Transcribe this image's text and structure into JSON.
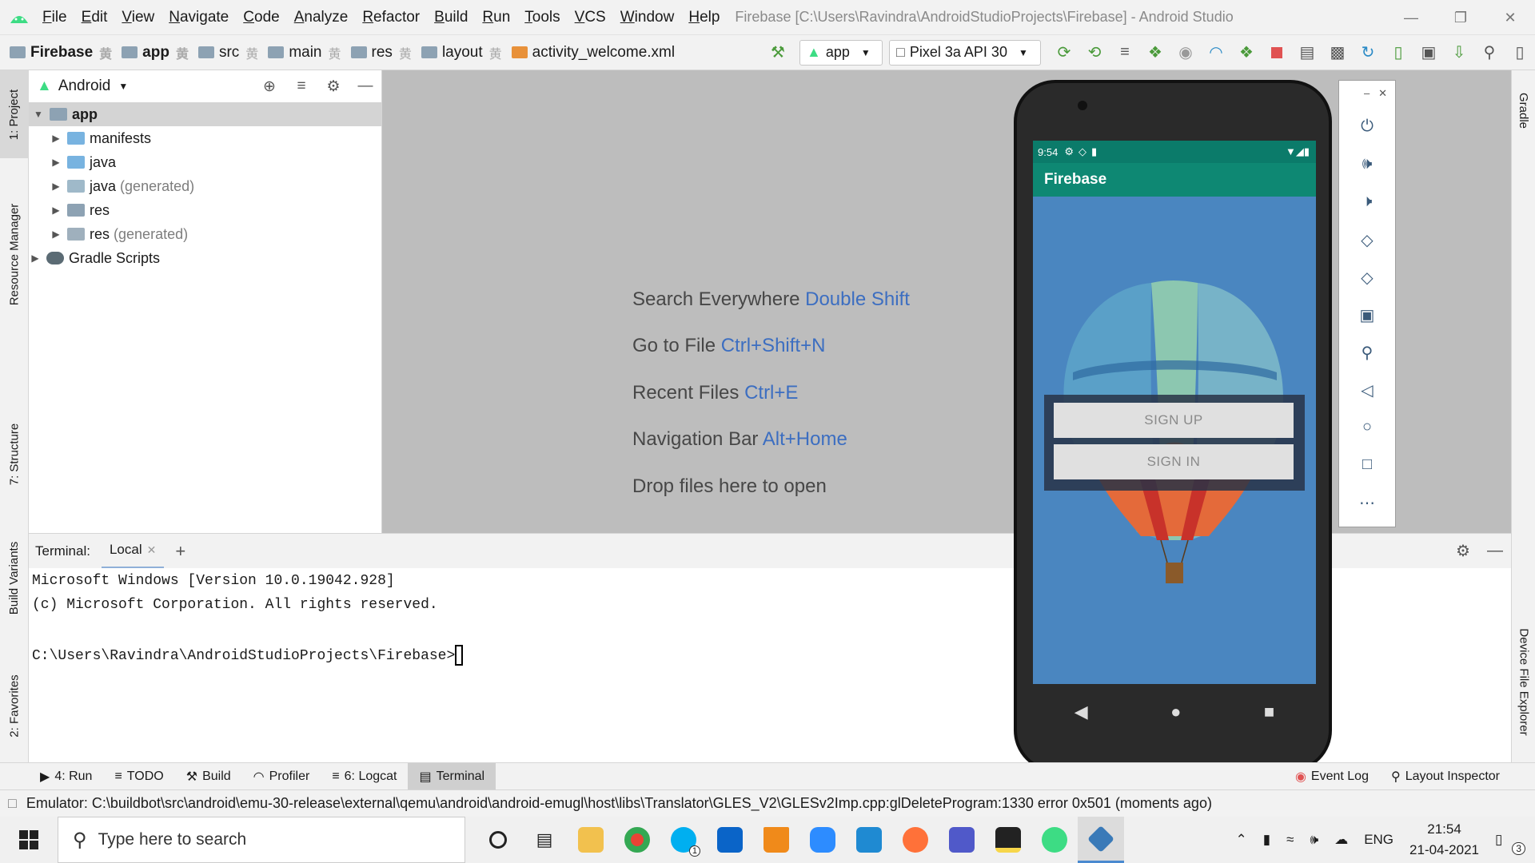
{
  "menu": {
    "items": [
      "File",
      "Edit",
      "View",
      "Navigate",
      "Code",
      "Analyze",
      "Refactor",
      "Build",
      "Run",
      "Tools",
      "VCS",
      "Window",
      "Help"
    ],
    "window_title": "Firebase [C:\\Users\\Ravindra\\AndroidStudioProjects\\Firebase] - Android Studio"
  },
  "breadcrumbs": [
    "Firebase",
    "app",
    "src",
    "main",
    "res",
    "layout",
    "activity_welcome.xml"
  ],
  "toolbar": {
    "run_config": "app",
    "device": "Pixel 3a API 30"
  },
  "left_tabs": [
    "1: Project",
    "Resource Manager",
    "7: Structure",
    "Build Variants",
    "2: Favorites"
  ],
  "right_tabs": [
    "Gradle",
    "Device File Explorer"
  ],
  "project": {
    "view": "Android",
    "tree": [
      {
        "label": "app",
        "suffix": ""
      },
      {
        "label": "manifests",
        "suffix": ""
      },
      {
        "label": "java",
        "suffix": ""
      },
      {
        "label": "java",
        "suffix": "(generated)"
      },
      {
        "label": "res",
        "suffix": ""
      },
      {
        "label": "res",
        "suffix": "(generated)"
      },
      {
        "label": "Gradle Scripts",
        "suffix": ""
      }
    ]
  },
  "editor_hints": [
    {
      "text": "Search Everywhere",
      "key": "Double Shift"
    },
    {
      "text": "Go to File",
      "key": "Ctrl+Shift+N"
    },
    {
      "text": "Recent Files",
      "key": "Ctrl+E"
    },
    {
      "text": "Navigation Bar",
      "key": "Alt+Home"
    },
    {
      "text": "Drop files here to open",
      "key": ""
    }
  ],
  "emulator": {
    "time": "9:54",
    "app_title": "Firebase",
    "signup_label": "SIGN UP",
    "signin_label": "SIGN IN",
    "side_icons": [
      "power-icon",
      "volume-up-icon",
      "volume-down-icon",
      "rotate-left-icon",
      "rotate-right-icon",
      "camera-icon",
      "zoom-icon",
      "back-icon",
      "home-icon",
      "overview-icon",
      "more-icon"
    ]
  },
  "terminal": {
    "title": "Terminal:",
    "tab": "Local",
    "lines": [
      "Microsoft Windows [Version 10.0.19042.928]",
      "(c) Microsoft Corporation. All rights reserved.",
      "",
      "C:\\Users\\Ravindra\\AndroidStudioProjects\\Firebase>"
    ]
  },
  "bottom_tools": [
    "4: Run",
    "TODO",
    "Build",
    "Profiler",
    "6: Logcat",
    "Terminal"
  ],
  "bottom_right": [
    "Event Log",
    "Layout Inspector"
  ],
  "status": "Emulator: C:\\buildbot\\src\\android\\emu-30-release\\external\\qemu\\android\\android-emugl\\host\\libs\\Translator\\GLES_V2\\GLESv2Imp.cpp:glDeleteProgram:1330 error 0x501 (moments ago)",
  "taskbar": {
    "search_placeholder": "Type here to search",
    "lang": "ENG",
    "time": "21:54",
    "date": "21-04-2021",
    "notifications": "3",
    "skype_badge": "1"
  },
  "colors": {
    "accent_link": "#3c6ec1",
    "app_bar": "#0e8873",
    "phone_bg": "#4a86c0"
  }
}
